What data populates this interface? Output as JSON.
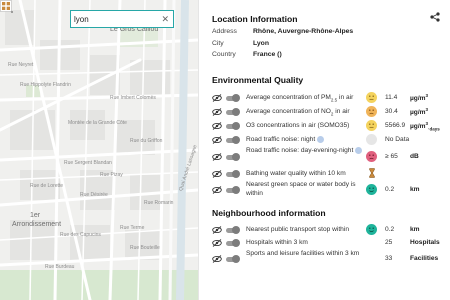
{
  "map": {
    "search_value": "lyon",
    "labels": {
      "le_gros_caillou": "Le Gros Caillou",
      "arrondissement_1": "1er",
      "arrondissement_2": "Arrondissement",
      "quai": "Quai André Lassagne",
      "rue_burdeau": "Rue Burdeau",
      "rue_bouteille": "Rue Bouteille",
      "rue_terme": "Rue Terme",
      "rue_imbert": "Rue Imbert Colomès",
      "rue_sergent_blandan": "Rue Sergent Blandan",
      "rue_lorette": "Rue de Lorette",
      "rue_hippolyte": "Rue Hippolyte Flandrin",
      "rue_romarin": "Rue Romarin",
      "rue_desiree": "Rue Désirée",
      "rue_du_griffon": "Rue du Griffon",
      "rue_pizay": "Rue Pizay",
      "grande_cote": "Montée de la Grande Côte",
      "rue_neyret": "Rue Neyret",
      "rue_capucins": "Rue des Capucins"
    }
  },
  "location": {
    "title": "Location Information",
    "address_label": "Address",
    "address_value": "Rhône, Auvergne-Rhône-Alpes",
    "city_label": "City",
    "city_value": "Lyon",
    "country_label": "Country",
    "country_value": "France ()"
  },
  "environment": {
    "title": "Environmental Quality",
    "pm25": {
      "label_pre": "Average concentration of PM",
      "label_sub": "2.5",
      "label_post": " in air",
      "value": "11.4",
      "unit": "µg/m",
      "unit_sup": "3",
      "face_color": "#f4d35e",
      "face": "neutral"
    },
    "no2": {
      "label_pre": "Average concentration of NO",
      "label_sub": "2",
      "label_post": " in air",
      "value": "30.4",
      "unit": "µg/m",
      "unit_sup": "3",
      "face_color": "#f0b45a",
      "face": "sad"
    },
    "o3": {
      "label": "O3 concentrations in air (SOMO35)",
      "value": "5566.9",
      "unit": "µg/m",
      "unit_sup": "3",
      "unit_tail": "·days",
      "face_color": "#f4d35e",
      "face": "neutral"
    },
    "noise_night": {
      "label": "Road traffic noise: night",
      "value": "No Data",
      "face_color": "#e6e6e6",
      "face": "blank"
    },
    "noise_den": {
      "label": "Road traffic noise: day-evening-night",
      "value": "≥ 65",
      "unit": "dB",
      "face_color": "#e0607e",
      "face": "sad"
    },
    "bathing": {
      "label": "Bathing water quality within 10 km",
      "icon": "hourglass-icon"
    },
    "green": {
      "label": "Nearest green space or water body is within",
      "value": "0.2",
      "unit": "km",
      "face_color": "#1fb49b",
      "face": "happy"
    }
  },
  "neighbourhood": {
    "title": "Neighbourhood information",
    "transport": {
      "label": "Nearest public transport stop within",
      "value": "0.2",
      "unit": "km",
      "face_color": "#1fb49b",
      "face": "happy"
    },
    "hospitals": {
      "label": "Hospitals within 3 km",
      "value": "25",
      "unit": "Hospitals"
    },
    "sports": {
      "label": "Sports and leisure facilities within 3 km",
      "value": "33",
      "unit": "Facilities"
    }
  }
}
